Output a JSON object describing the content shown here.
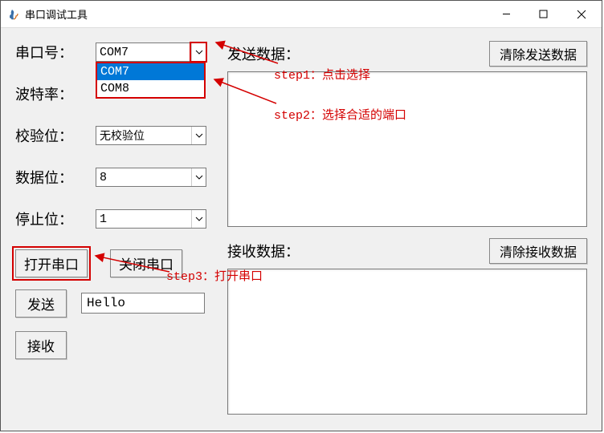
{
  "window": {
    "title": "串口调试工具"
  },
  "left": {
    "port_label": "串口号：",
    "port_value": "COM7",
    "port_options": [
      "COM7",
      "COM8"
    ],
    "baud_label": "波特率：",
    "parity_label": "校验位：",
    "parity_value": "无校验位",
    "databits_label": "数据位：",
    "databits_value": "8",
    "stopbits_label": "停止位：",
    "stopbits_value": "1",
    "open_btn": "打开串口",
    "close_btn": "关闭串口",
    "send_btn": "发送",
    "send_value": "Hello",
    "recv_btn": "接收"
  },
  "right": {
    "send_label": "发送数据：",
    "clear_send": "清除发送数据",
    "recv_label": "接收数据：",
    "clear_recv": "清除接收数据"
  },
  "annotations": {
    "step1": "step1：点击选择",
    "step2": "step2：选择合适的端口",
    "step3": "step3：打开串口"
  },
  "colors": {
    "highlight": "#d40000",
    "select_bg": "#0078d7"
  }
}
